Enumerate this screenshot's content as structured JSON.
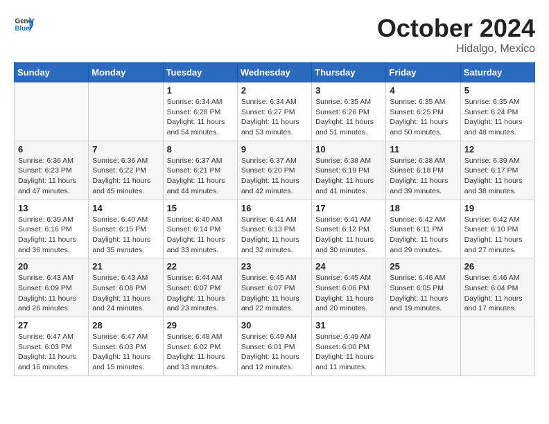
{
  "header": {
    "logo_general": "General",
    "logo_blue": "Blue",
    "month": "October 2024",
    "location": "Hidalgo, Mexico"
  },
  "weekdays": [
    "Sunday",
    "Monday",
    "Tuesday",
    "Wednesday",
    "Thursday",
    "Friday",
    "Saturday"
  ],
  "weeks": [
    [
      {
        "day": "",
        "sunrise": "",
        "sunset": "",
        "daylight": ""
      },
      {
        "day": "",
        "sunrise": "",
        "sunset": "",
        "daylight": ""
      },
      {
        "day": "1",
        "sunrise": "Sunrise: 6:34 AM",
        "sunset": "Sunset: 6:28 PM",
        "daylight": "Daylight: 11 hours and 54 minutes."
      },
      {
        "day": "2",
        "sunrise": "Sunrise: 6:34 AM",
        "sunset": "Sunset: 6:27 PM",
        "daylight": "Daylight: 11 hours and 53 minutes."
      },
      {
        "day": "3",
        "sunrise": "Sunrise: 6:35 AM",
        "sunset": "Sunset: 6:26 PM",
        "daylight": "Daylight: 11 hours and 51 minutes."
      },
      {
        "day": "4",
        "sunrise": "Sunrise: 6:35 AM",
        "sunset": "Sunset: 6:25 PM",
        "daylight": "Daylight: 11 hours and 50 minutes."
      },
      {
        "day": "5",
        "sunrise": "Sunrise: 6:35 AM",
        "sunset": "Sunset: 6:24 PM",
        "daylight": "Daylight: 11 hours and 48 minutes."
      }
    ],
    [
      {
        "day": "6",
        "sunrise": "Sunrise: 6:36 AM",
        "sunset": "Sunset: 6:23 PM",
        "daylight": "Daylight: 11 hours and 47 minutes."
      },
      {
        "day": "7",
        "sunrise": "Sunrise: 6:36 AM",
        "sunset": "Sunset: 6:22 PM",
        "daylight": "Daylight: 11 hours and 45 minutes."
      },
      {
        "day": "8",
        "sunrise": "Sunrise: 6:37 AM",
        "sunset": "Sunset: 6:21 PM",
        "daylight": "Daylight: 11 hours and 44 minutes."
      },
      {
        "day": "9",
        "sunrise": "Sunrise: 6:37 AM",
        "sunset": "Sunset: 6:20 PM",
        "daylight": "Daylight: 11 hours and 42 minutes."
      },
      {
        "day": "10",
        "sunrise": "Sunrise: 6:38 AM",
        "sunset": "Sunset: 6:19 PM",
        "daylight": "Daylight: 11 hours and 41 minutes."
      },
      {
        "day": "11",
        "sunrise": "Sunrise: 6:38 AM",
        "sunset": "Sunset: 6:18 PM",
        "daylight": "Daylight: 11 hours and 39 minutes."
      },
      {
        "day": "12",
        "sunrise": "Sunrise: 6:39 AM",
        "sunset": "Sunset: 6:17 PM",
        "daylight": "Daylight: 11 hours and 38 minutes."
      }
    ],
    [
      {
        "day": "13",
        "sunrise": "Sunrise: 6:39 AM",
        "sunset": "Sunset: 6:16 PM",
        "daylight": "Daylight: 11 hours and 36 minutes."
      },
      {
        "day": "14",
        "sunrise": "Sunrise: 6:40 AM",
        "sunset": "Sunset: 6:15 PM",
        "daylight": "Daylight: 11 hours and 35 minutes."
      },
      {
        "day": "15",
        "sunrise": "Sunrise: 6:40 AM",
        "sunset": "Sunset: 6:14 PM",
        "daylight": "Daylight: 11 hours and 33 minutes."
      },
      {
        "day": "16",
        "sunrise": "Sunrise: 6:41 AM",
        "sunset": "Sunset: 6:13 PM",
        "daylight": "Daylight: 11 hours and 32 minutes."
      },
      {
        "day": "17",
        "sunrise": "Sunrise: 6:41 AM",
        "sunset": "Sunset: 6:12 PM",
        "daylight": "Daylight: 11 hours and 30 minutes."
      },
      {
        "day": "18",
        "sunrise": "Sunrise: 6:42 AM",
        "sunset": "Sunset: 6:11 PM",
        "daylight": "Daylight: 11 hours and 29 minutes."
      },
      {
        "day": "19",
        "sunrise": "Sunrise: 6:42 AM",
        "sunset": "Sunset: 6:10 PM",
        "daylight": "Daylight: 11 hours and 27 minutes."
      }
    ],
    [
      {
        "day": "20",
        "sunrise": "Sunrise: 6:43 AM",
        "sunset": "Sunset: 6:09 PM",
        "daylight": "Daylight: 11 hours and 26 minutes."
      },
      {
        "day": "21",
        "sunrise": "Sunrise: 6:43 AM",
        "sunset": "Sunset: 6:08 PM",
        "daylight": "Daylight: 11 hours and 24 minutes."
      },
      {
        "day": "22",
        "sunrise": "Sunrise: 6:44 AM",
        "sunset": "Sunset: 6:07 PM",
        "daylight": "Daylight: 11 hours and 23 minutes."
      },
      {
        "day": "23",
        "sunrise": "Sunrise: 6:45 AM",
        "sunset": "Sunset: 6:07 PM",
        "daylight": "Daylight: 11 hours and 22 minutes."
      },
      {
        "day": "24",
        "sunrise": "Sunrise: 6:45 AM",
        "sunset": "Sunset: 6:06 PM",
        "daylight": "Daylight: 11 hours and 20 minutes."
      },
      {
        "day": "25",
        "sunrise": "Sunrise: 6:46 AM",
        "sunset": "Sunset: 6:05 PM",
        "daylight": "Daylight: 11 hours and 19 minutes."
      },
      {
        "day": "26",
        "sunrise": "Sunrise: 6:46 AM",
        "sunset": "Sunset: 6:04 PM",
        "daylight": "Daylight: 11 hours and 17 minutes."
      }
    ],
    [
      {
        "day": "27",
        "sunrise": "Sunrise: 6:47 AM",
        "sunset": "Sunset: 6:03 PM",
        "daylight": "Daylight: 11 hours and 16 minutes."
      },
      {
        "day": "28",
        "sunrise": "Sunrise: 6:47 AM",
        "sunset": "Sunset: 6:03 PM",
        "daylight": "Daylight: 11 hours and 15 minutes."
      },
      {
        "day": "29",
        "sunrise": "Sunrise: 6:48 AM",
        "sunset": "Sunset: 6:02 PM",
        "daylight": "Daylight: 11 hours and 13 minutes."
      },
      {
        "day": "30",
        "sunrise": "Sunrise: 6:49 AM",
        "sunset": "Sunset: 6:01 PM",
        "daylight": "Daylight: 11 hours and 12 minutes."
      },
      {
        "day": "31",
        "sunrise": "Sunrise: 6:49 AM",
        "sunset": "Sunset: 6:00 PM",
        "daylight": "Daylight: 11 hours and 11 minutes."
      },
      {
        "day": "",
        "sunrise": "",
        "sunset": "",
        "daylight": ""
      },
      {
        "day": "",
        "sunrise": "",
        "sunset": "",
        "daylight": ""
      }
    ]
  ]
}
